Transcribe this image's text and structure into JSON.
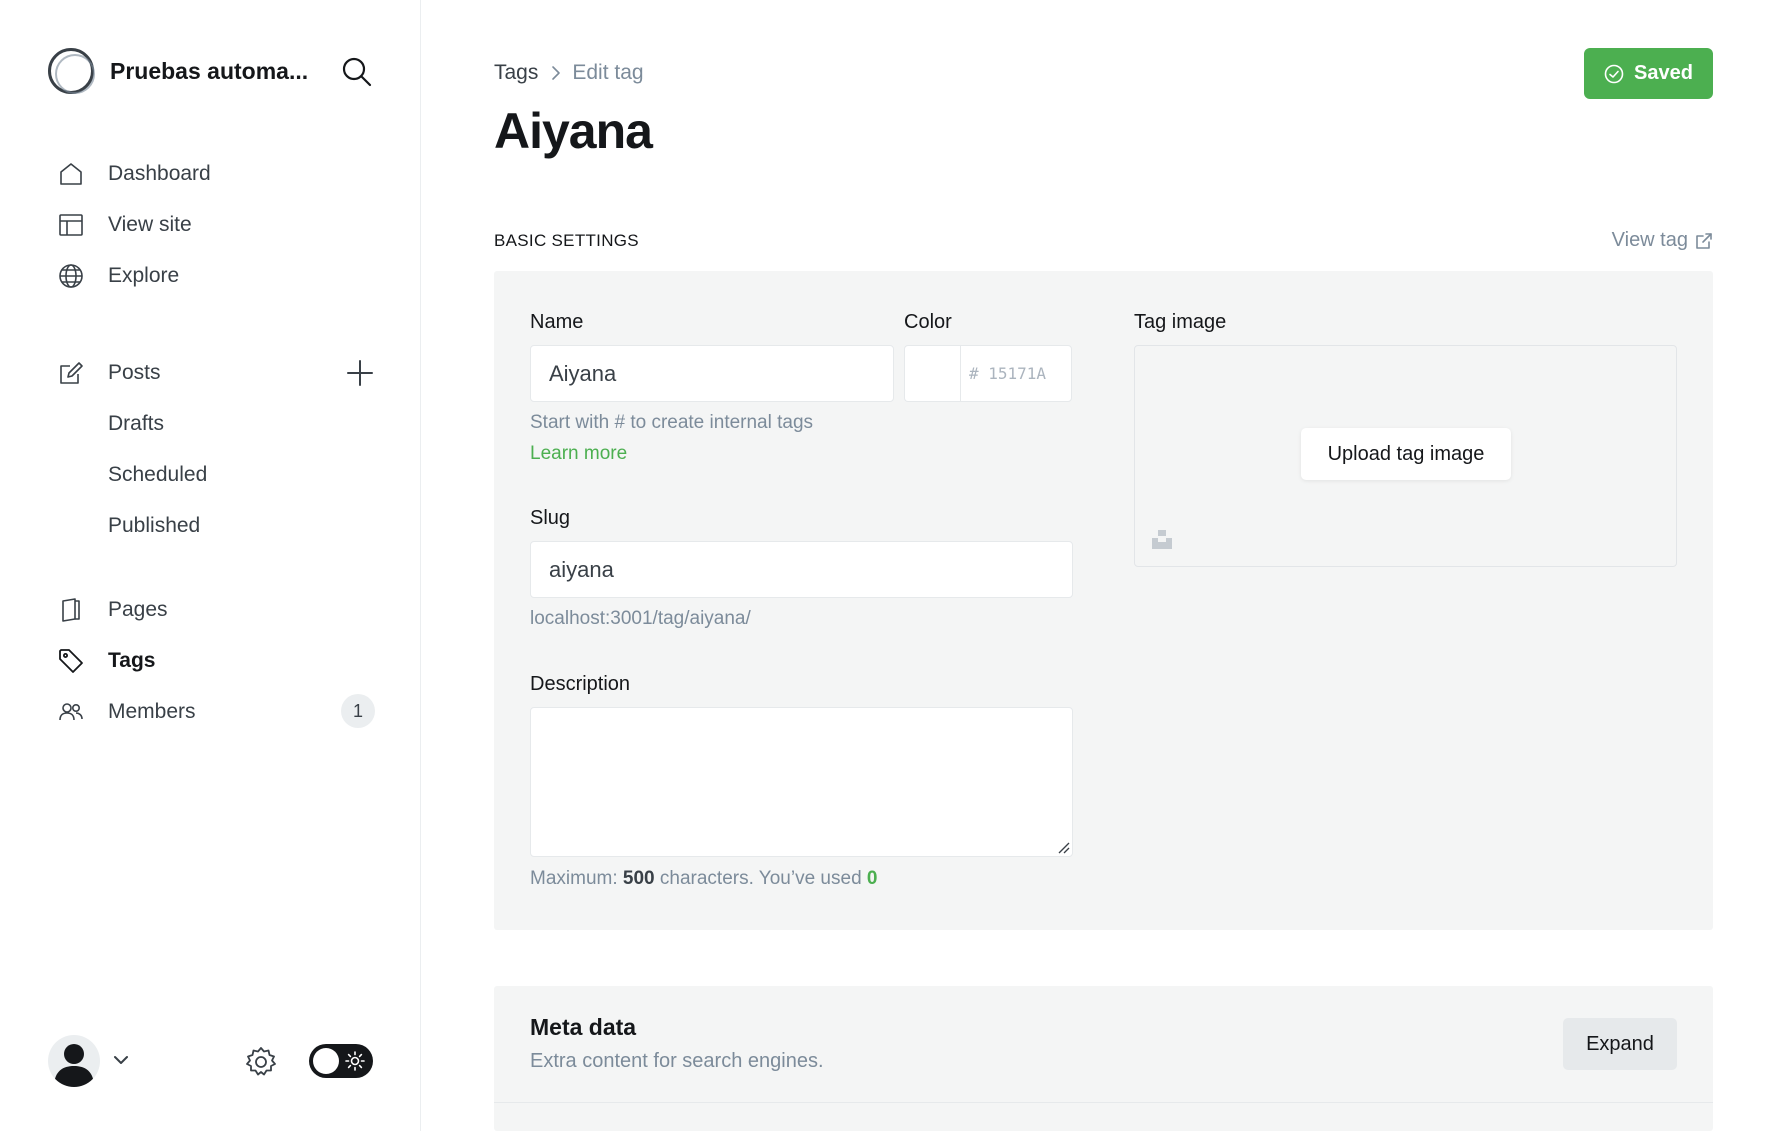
{
  "sidebar": {
    "site_name": "Pruebas automa...",
    "nav_primary": [
      {
        "label": "Dashboard",
        "icon": "home-icon"
      },
      {
        "label": "View site",
        "icon": "layout-icon"
      },
      {
        "label": "Explore",
        "icon": "globe-icon"
      }
    ],
    "posts": {
      "label": "Posts",
      "icon": "edit-icon"
    },
    "posts_sub": [
      {
        "label": "Drafts"
      },
      {
        "label": "Scheduled"
      },
      {
        "label": "Published"
      }
    ],
    "nav_secondary": [
      {
        "label": "Pages",
        "icon": "page-icon"
      },
      {
        "label": "Tags",
        "icon": "tag-icon"
      },
      {
        "label": "Members",
        "icon": "members-icon",
        "count": "1"
      }
    ]
  },
  "header": {
    "breadcrumb_root": "Tags",
    "breadcrumb_current": "Edit tag",
    "title": "Aiyana",
    "saved_label": "Saved"
  },
  "basic_settings": {
    "section_title": "BASIC SETTINGS",
    "view_tag_label": "View tag",
    "name_label": "Name",
    "name_value": "Aiyana",
    "name_hint": "Start with # to create internal tags",
    "learn_more": "Learn more",
    "color_label": "Color",
    "color_placeholder": "# 15171A",
    "slug_label": "Slug",
    "slug_value": "aiyana",
    "slug_url": "localhost:3001/tag/aiyana/",
    "description_label": "Description",
    "description_value": "",
    "counter_prefix": "Maximum: ",
    "counter_max": "500",
    "counter_mid": " characters. You’ve used ",
    "counter_used": "0",
    "tag_image_label": "Tag image",
    "upload_label": "Upload tag image"
  },
  "meta_data": {
    "title": "Meta data",
    "subtitle": "Extra content for search engines.",
    "expand_label": "Expand"
  },
  "colors": {
    "accent": "#4caf50",
    "panel_bg": "#f4f5f5",
    "text_dark": "#15171a",
    "text_muted": "#7c8b9a"
  }
}
